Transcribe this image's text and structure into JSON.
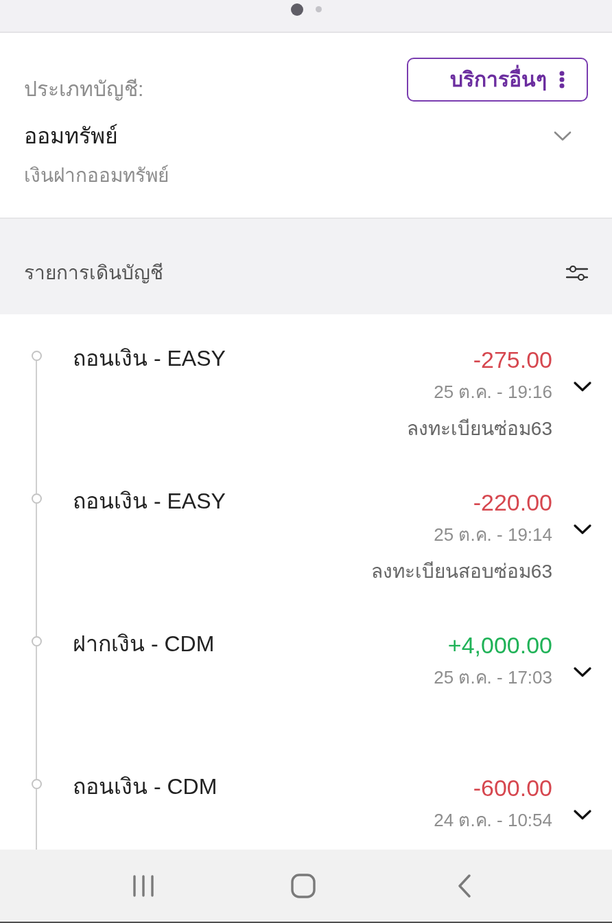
{
  "page_indicator": [
    {
      "selected": true
    },
    {
      "selected": false
    }
  ],
  "account": {
    "label": "ประเภทบัญชี:",
    "services_button": "บริการอื่นๆ",
    "type": "ออมทรัพย์",
    "subtype": "เงินฝากออมทรัพย์"
  },
  "statement": {
    "title": "รายการเดินบัญชี"
  },
  "transactions": [
    {
      "kind": "debit",
      "title": "ถอนเงิน - EASY",
      "amount": "-275.00",
      "datetime": "25 ต.ค. - 19:16",
      "note": "ลงทะเบียนซ่อม63"
    },
    {
      "kind": "debit",
      "title": "ถอนเงิน - EASY",
      "amount": "-220.00",
      "datetime": "25 ต.ค. - 19:14",
      "note": "ลงทะเบียนสอบซ่อม63"
    },
    {
      "kind": "credit",
      "title": "ฝากเงิน - CDM",
      "amount": "+4,000.00",
      "datetime": "25 ต.ค. - 17:03"
    },
    {
      "kind": "debit",
      "title": "ถอนเงิน - CDM",
      "amount": "-600.00",
      "datetime": "24 ต.ค. - 10:54"
    }
  ]
}
